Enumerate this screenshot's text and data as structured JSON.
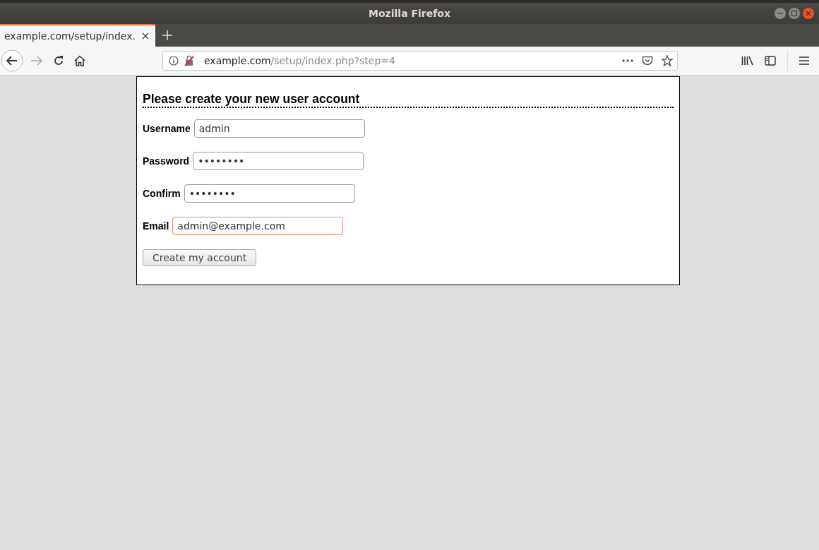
{
  "window": {
    "title": "Mozilla Firefox"
  },
  "tabs": [
    {
      "label": "example.com/setup/index.",
      "selected": true
    }
  ],
  "address_bar": {
    "host": "example.com",
    "path": "/setup/index.php?step=4"
  },
  "form": {
    "heading": "Please create your new user account",
    "fields": [
      {
        "label": "Username",
        "value": "admin",
        "focused": false
      },
      {
        "label": "Password",
        "value": "••••••••",
        "focused": false
      },
      {
        "label": "Confirm",
        "value": "••••••••",
        "focused": false
      },
      {
        "label": "Email",
        "value": "admin@example.com",
        "focused": true
      }
    ],
    "submit": "Create my account"
  }
}
